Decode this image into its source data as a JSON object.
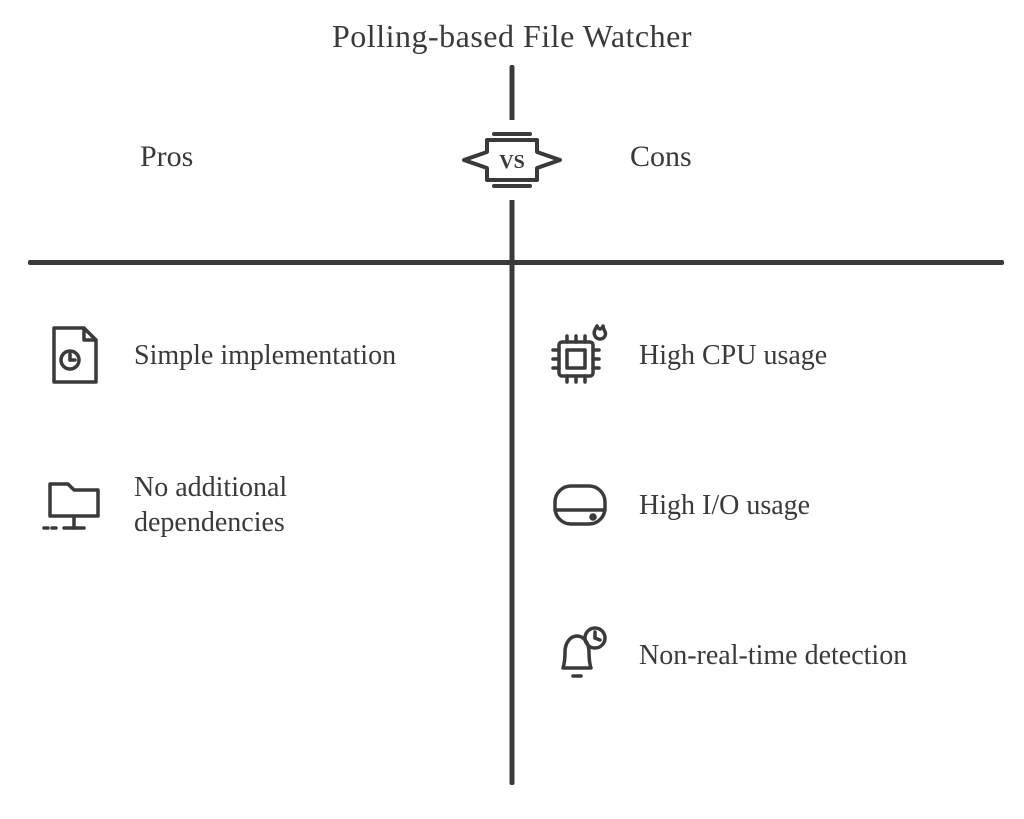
{
  "title": "Polling-based File Watcher",
  "vs_label": "VS",
  "columns": {
    "pros": {
      "header": "Pros",
      "items": [
        {
          "icon": "file-clock-icon",
          "text": "Simple implementation"
        },
        {
          "icon": "folder-network-icon",
          "text": "No additional dependencies"
        }
      ]
    },
    "cons": {
      "header": "Cons",
      "items": [
        {
          "icon": "cpu-fire-icon",
          "text": "High CPU usage"
        },
        {
          "icon": "disk-icon",
          "text": "High I/O usage"
        },
        {
          "icon": "bell-clock-icon",
          "text": "Non-real-time detection"
        }
      ]
    }
  }
}
